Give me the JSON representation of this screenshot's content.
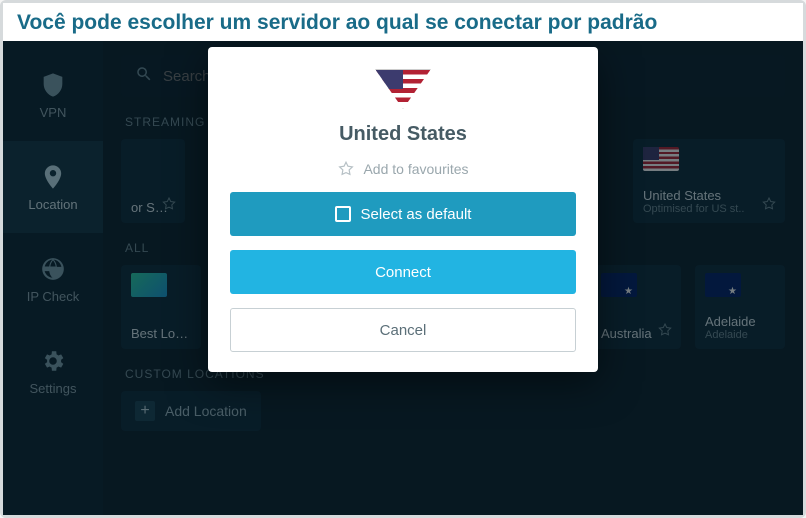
{
  "banner": {
    "headline": "Você pode escolher um servidor ao qual se conectar por padrão"
  },
  "sidebar": {
    "items": [
      {
        "label": "VPN"
      },
      {
        "label": "Location"
      },
      {
        "label": "IP Check"
      },
      {
        "label": "Settings"
      }
    ]
  },
  "search": {
    "placeholder": "Search location"
  },
  "sections": {
    "streaming_label": "STREAMING",
    "all_label": "ALL",
    "custom_label": "CUSTOM LOCATIONS"
  },
  "streaming_cards": [
    {
      "title": "or Swed.."
    },
    {
      "title": "United States",
      "sub": "Optimised for US st.."
    }
  ],
  "all_cards": [
    {
      "title": "Best Location"
    },
    {
      "title": "Australia",
      "sub": ""
    },
    {
      "title": "Adelaide",
      "sub": "Adelaide"
    }
  ],
  "add_location_label": "Add Location",
  "modal": {
    "country": "United States",
    "favourite_label": "Add to favourites",
    "default_label": "Select as default",
    "connect_label": "Connect",
    "cancel_label": "Cancel"
  }
}
